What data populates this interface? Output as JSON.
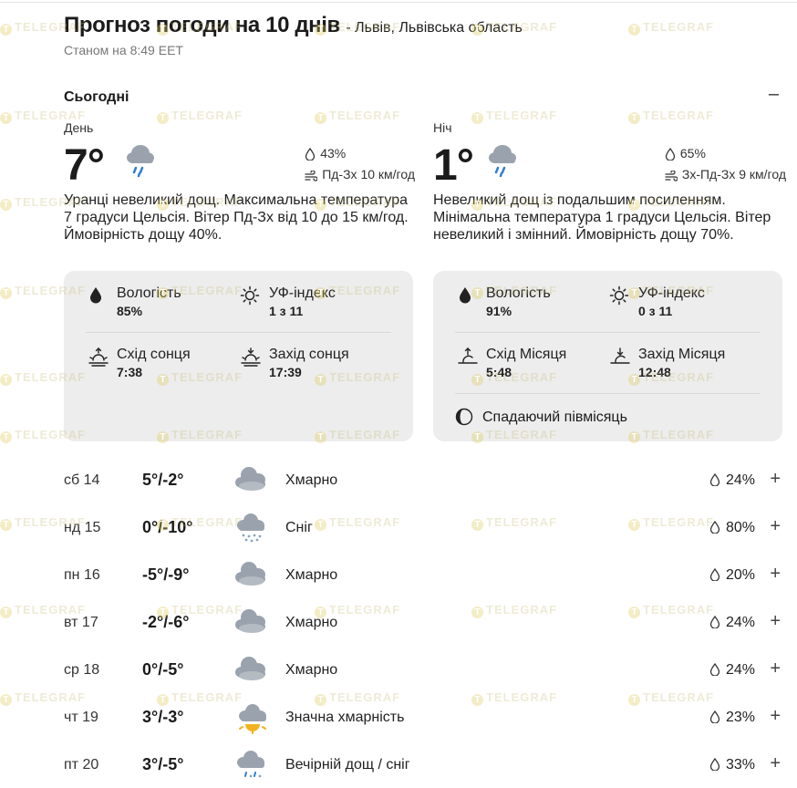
{
  "header": {
    "title": "Прогноз погоди на 10 днів",
    "location": "- Львів, Львівська область",
    "as_of": "Станом на 8:49 EET"
  },
  "today": {
    "label": "Сьогодні",
    "collapse_label": "–",
    "day": {
      "label": "День",
      "temp": "7°",
      "icon": "rain-cloud-icon",
      "humidity": "43%",
      "wind": "Пд-Зх 10 км/год",
      "description": "Уранці невеликий дощ. Максимальна температура 7 градуси Цельсія. Вітер Пд-Зх від 10 до 15 км/год. Ймовірність дощу 40%.",
      "details": {
        "humidity_label": "Вологість",
        "humidity_value": "85%",
        "uv_label": "УФ-індекс",
        "uv_value": "1 з 11",
        "rise_label": "Схід сонця",
        "rise_value": "7:38",
        "set_label": "Захід сонця",
        "set_value": "17:39"
      }
    },
    "night": {
      "label": "Ніч",
      "temp": "1°",
      "icon": "rain-cloud-icon",
      "humidity": "65%",
      "wind": "Зх-Пд-Зх 9 км/год",
      "description": "Невеликий дощ із подальшим посиленням. Мінімальна температура 1 градуси Цельсія. Вітер невеликий і змінний. Ймовірність дощу 70%.",
      "details": {
        "humidity_label": "Вологість",
        "humidity_value": "91%",
        "uv_label": "УФ-індекс",
        "uv_value": "0 з 11",
        "rise_label": "Схід Місяця",
        "rise_value": "5:48",
        "set_label": "Захід Місяця",
        "set_value": "12:48",
        "moon_phase": "Спадаючий півмісяць"
      }
    }
  },
  "forecast": [
    {
      "day": "сб 14",
      "temps": "5°/-2°",
      "condition": "Хмарно",
      "precip": "24%",
      "icon": "cloudy-icon"
    },
    {
      "day": "нд 15",
      "temps": "0°/-10°",
      "condition": "Сніг",
      "precip": "80%",
      "icon": "snow-icon"
    },
    {
      "day": "пн 16",
      "temps": "-5°/-9°",
      "condition": "Хмарно",
      "precip": "20%",
      "icon": "cloudy-icon"
    },
    {
      "day": "вт 17",
      "temps": "-2°/-6°",
      "condition": "Хмарно",
      "precip": "24%",
      "icon": "cloudy-icon"
    },
    {
      "day": "ср 18",
      "temps": "0°/-5°",
      "condition": "Хмарно",
      "precip": "24%",
      "icon": "cloudy-icon"
    },
    {
      "day": "чт 19",
      "temps": "3°/-3°",
      "condition": "Значна хмарність",
      "precip": "23%",
      "icon": "partly-sunny-icon"
    },
    {
      "day": "пт 20",
      "temps": "3°/-5°",
      "condition": "Вечірній дощ / сніг",
      "precip": "33%",
      "icon": "rain-snow-icon"
    }
  ],
  "row_action": "+",
  "watermark": "TELEGRAF",
  "colors": {
    "card_bg": "#ededed",
    "cloud": "#9aa3ad",
    "rain": "#2f7fd0",
    "sun": "#f2b320"
  }
}
